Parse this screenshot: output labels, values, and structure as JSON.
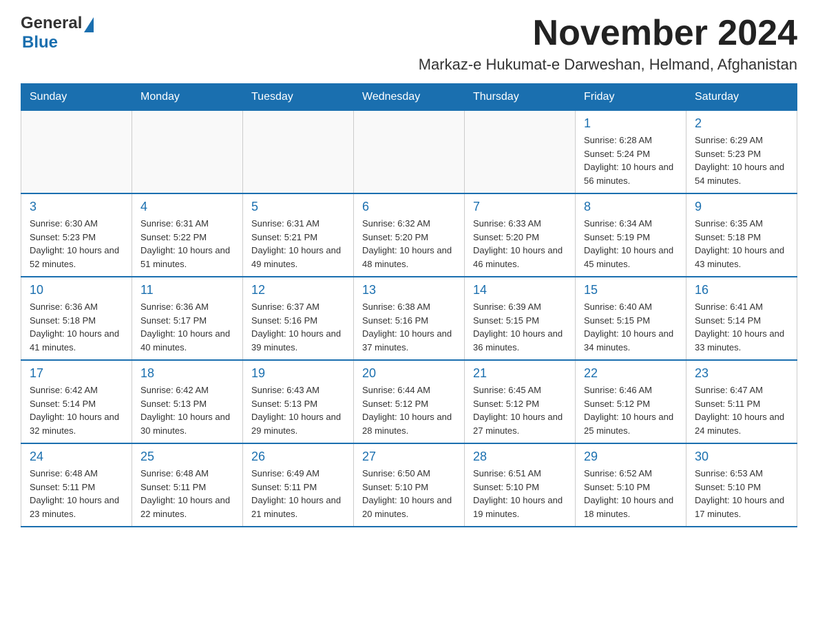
{
  "header": {
    "logo_general": "General",
    "logo_blue": "Blue",
    "month_title": "November 2024",
    "location": "Markaz-e Hukumat-e Darweshan, Helmand, Afghanistan"
  },
  "weekdays": [
    "Sunday",
    "Monday",
    "Tuesday",
    "Wednesday",
    "Thursday",
    "Friday",
    "Saturday"
  ],
  "weeks": [
    {
      "days": [
        {
          "number": "",
          "info": ""
        },
        {
          "number": "",
          "info": ""
        },
        {
          "number": "",
          "info": ""
        },
        {
          "number": "",
          "info": ""
        },
        {
          "number": "",
          "info": ""
        },
        {
          "number": "1",
          "info": "Sunrise: 6:28 AM\nSunset: 5:24 PM\nDaylight: 10 hours and 56 minutes."
        },
        {
          "number": "2",
          "info": "Sunrise: 6:29 AM\nSunset: 5:23 PM\nDaylight: 10 hours and 54 minutes."
        }
      ]
    },
    {
      "days": [
        {
          "number": "3",
          "info": "Sunrise: 6:30 AM\nSunset: 5:23 PM\nDaylight: 10 hours and 52 minutes."
        },
        {
          "number": "4",
          "info": "Sunrise: 6:31 AM\nSunset: 5:22 PM\nDaylight: 10 hours and 51 minutes."
        },
        {
          "number": "5",
          "info": "Sunrise: 6:31 AM\nSunset: 5:21 PM\nDaylight: 10 hours and 49 minutes."
        },
        {
          "number": "6",
          "info": "Sunrise: 6:32 AM\nSunset: 5:20 PM\nDaylight: 10 hours and 48 minutes."
        },
        {
          "number": "7",
          "info": "Sunrise: 6:33 AM\nSunset: 5:20 PM\nDaylight: 10 hours and 46 minutes."
        },
        {
          "number": "8",
          "info": "Sunrise: 6:34 AM\nSunset: 5:19 PM\nDaylight: 10 hours and 45 minutes."
        },
        {
          "number": "9",
          "info": "Sunrise: 6:35 AM\nSunset: 5:18 PM\nDaylight: 10 hours and 43 minutes."
        }
      ]
    },
    {
      "days": [
        {
          "number": "10",
          "info": "Sunrise: 6:36 AM\nSunset: 5:18 PM\nDaylight: 10 hours and 41 minutes."
        },
        {
          "number": "11",
          "info": "Sunrise: 6:36 AM\nSunset: 5:17 PM\nDaylight: 10 hours and 40 minutes."
        },
        {
          "number": "12",
          "info": "Sunrise: 6:37 AM\nSunset: 5:16 PM\nDaylight: 10 hours and 39 minutes."
        },
        {
          "number": "13",
          "info": "Sunrise: 6:38 AM\nSunset: 5:16 PM\nDaylight: 10 hours and 37 minutes."
        },
        {
          "number": "14",
          "info": "Sunrise: 6:39 AM\nSunset: 5:15 PM\nDaylight: 10 hours and 36 minutes."
        },
        {
          "number": "15",
          "info": "Sunrise: 6:40 AM\nSunset: 5:15 PM\nDaylight: 10 hours and 34 minutes."
        },
        {
          "number": "16",
          "info": "Sunrise: 6:41 AM\nSunset: 5:14 PM\nDaylight: 10 hours and 33 minutes."
        }
      ]
    },
    {
      "days": [
        {
          "number": "17",
          "info": "Sunrise: 6:42 AM\nSunset: 5:14 PM\nDaylight: 10 hours and 32 minutes."
        },
        {
          "number": "18",
          "info": "Sunrise: 6:42 AM\nSunset: 5:13 PM\nDaylight: 10 hours and 30 minutes."
        },
        {
          "number": "19",
          "info": "Sunrise: 6:43 AM\nSunset: 5:13 PM\nDaylight: 10 hours and 29 minutes."
        },
        {
          "number": "20",
          "info": "Sunrise: 6:44 AM\nSunset: 5:12 PM\nDaylight: 10 hours and 28 minutes."
        },
        {
          "number": "21",
          "info": "Sunrise: 6:45 AM\nSunset: 5:12 PM\nDaylight: 10 hours and 27 minutes."
        },
        {
          "number": "22",
          "info": "Sunrise: 6:46 AM\nSunset: 5:12 PM\nDaylight: 10 hours and 25 minutes."
        },
        {
          "number": "23",
          "info": "Sunrise: 6:47 AM\nSunset: 5:11 PM\nDaylight: 10 hours and 24 minutes."
        }
      ]
    },
    {
      "days": [
        {
          "number": "24",
          "info": "Sunrise: 6:48 AM\nSunset: 5:11 PM\nDaylight: 10 hours and 23 minutes."
        },
        {
          "number": "25",
          "info": "Sunrise: 6:48 AM\nSunset: 5:11 PM\nDaylight: 10 hours and 22 minutes."
        },
        {
          "number": "26",
          "info": "Sunrise: 6:49 AM\nSunset: 5:11 PM\nDaylight: 10 hours and 21 minutes."
        },
        {
          "number": "27",
          "info": "Sunrise: 6:50 AM\nSunset: 5:10 PM\nDaylight: 10 hours and 20 minutes."
        },
        {
          "number": "28",
          "info": "Sunrise: 6:51 AM\nSunset: 5:10 PM\nDaylight: 10 hours and 19 minutes."
        },
        {
          "number": "29",
          "info": "Sunrise: 6:52 AM\nSunset: 5:10 PM\nDaylight: 10 hours and 18 minutes."
        },
        {
          "number": "30",
          "info": "Sunrise: 6:53 AM\nSunset: 5:10 PM\nDaylight: 10 hours and 17 minutes."
        }
      ]
    }
  ]
}
